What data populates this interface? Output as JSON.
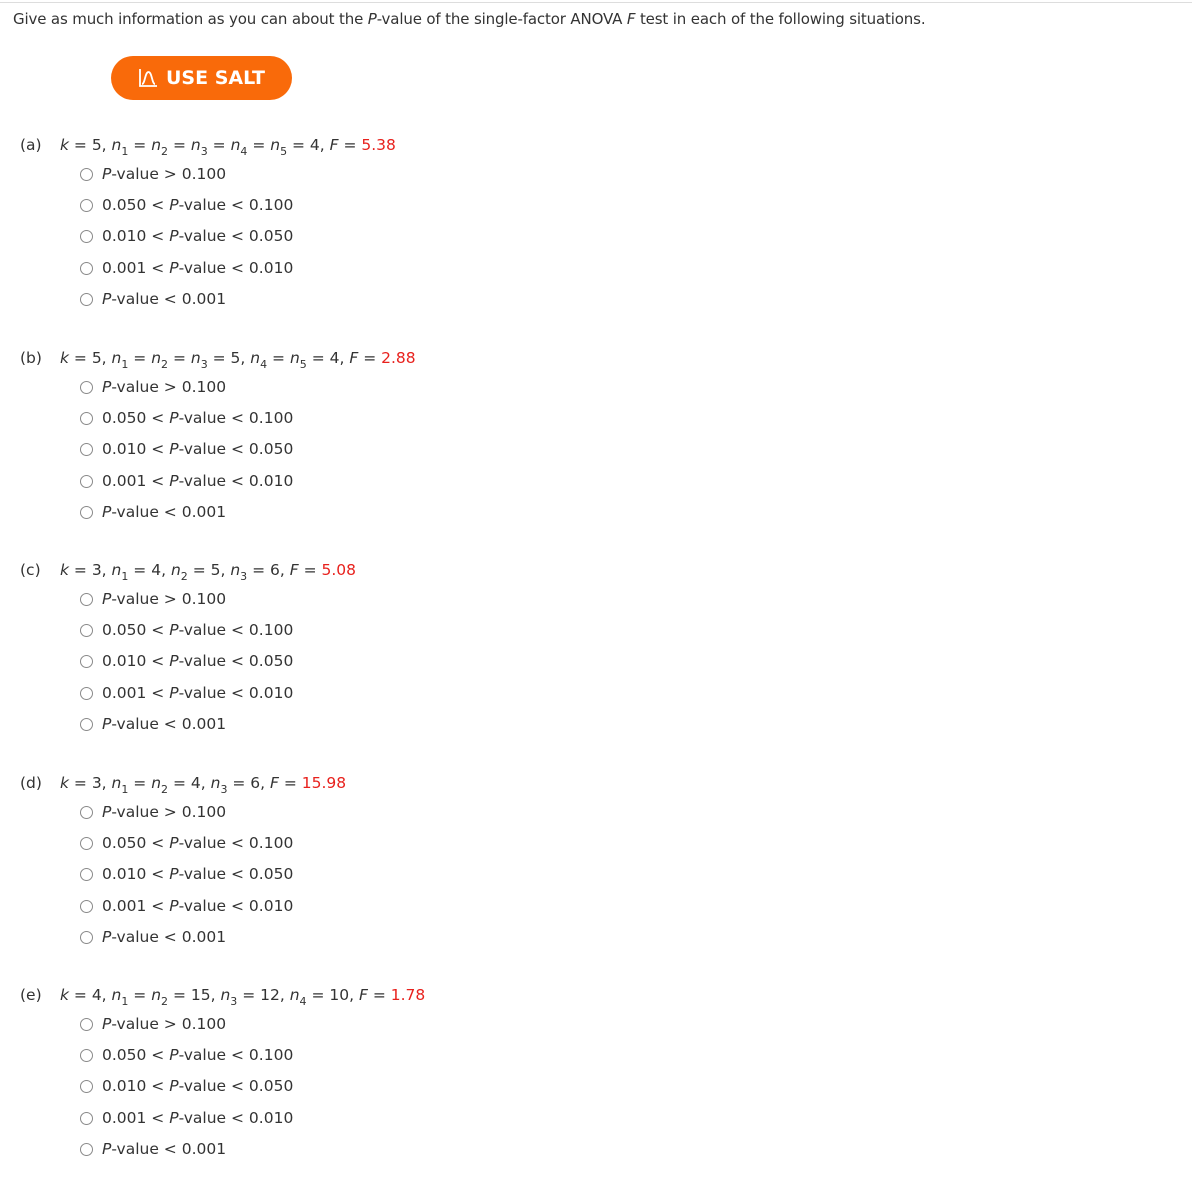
{
  "question": {
    "prefix": "Give as much information as you can about the ",
    "p_italic": "P",
    "middle": "-value of the single-factor ANOVA ",
    "f_italic": "F",
    "suffix": " test in each of the following situations."
  },
  "salt_button": {
    "label": "USE SALT",
    "icon": "distribution-curve-icon",
    "color": "#f96a0a"
  },
  "accent_color": "#e8211d",
  "options": [
    {
      "pre": "",
      "italic": "P",
      "post": "-value > 0.100"
    },
    {
      "pre": "0.050 < ",
      "italic": "P",
      "post": "-value < 0.100"
    },
    {
      "pre": "0.010 < ",
      "italic": "P",
      "post": "-value < 0.050"
    },
    {
      "pre": "0.001 < ",
      "italic": "P",
      "post": "-value < 0.010"
    },
    {
      "pre": "",
      "italic": "P",
      "post": "-value < 0.001"
    }
  ],
  "parts": [
    {
      "letter": "(a)",
      "tokens": [
        {
          "t": "k",
          "i": true
        },
        {
          "t": " = 5, "
        },
        {
          "t": "n",
          "i": true
        },
        {
          "s": "1"
        },
        {
          "t": " = "
        },
        {
          "t": "n",
          "i": true
        },
        {
          "s": "2"
        },
        {
          "t": " = "
        },
        {
          "t": "n",
          "i": true
        },
        {
          "s": "3"
        },
        {
          "t": " = "
        },
        {
          "t": "n",
          "i": true
        },
        {
          "s": "4"
        },
        {
          "t": " = "
        },
        {
          "t": "n",
          "i": true
        },
        {
          "s": "5"
        },
        {
          "t": " = 4, "
        },
        {
          "t": "F",
          "i": true
        },
        {
          "t": " = "
        }
      ],
      "F": "5.38"
    },
    {
      "letter": "(b)",
      "tokens": [
        {
          "t": "k",
          "i": true
        },
        {
          "t": " = 5, "
        },
        {
          "t": "n",
          "i": true
        },
        {
          "s": "1"
        },
        {
          "t": " = "
        },
        {
          "t": "n",
          "i": true
        },
        {
          "s": "2"
        },
        {
          "t": " = "
        },
        {
          "t": "n",
          "i": true
        },
        {
          "s": "3"
        },
        {
          "t": " = 5, "
        },
        {
          "t": "n",
          "i": true
        },
        {
          "s": "4"
        },
        {
          "t": " = "
        },
        {
          "t": "n",
          "i": true
        },
        {
          "s": "5"
        },
        {
          "t": " = 4, "
        },
        {
          "t": "F",
          "i": true
        },
        {
          "t": " = "
        }
      ],
      "F": "2.88"
    },
    {
      "letter": "(c)",
      "tokens": [
        {
          "t": "k",
          "i": true
        },
        {
          "t": " = 3, "
        },
        {
          "t": "n",
          "i": true
        },
        {
          "s": "1"
        },
        {
          "t": " = 4, "
        },
        {
          "t": "n",
          "i": true
        },
        {
          "s": "2"
        },
        {
          "t": " = 5, "
        },
        {
          "t": "n",
          "i": true
        },
        {
          "s": "3"
        },
        {
          "t": " = 6, "
        },
        {
          "t": "F",
          "i": true
        },
        {
          "t": " = "
        }
      ],
      "F": "5.08"
    },
    {
      "letter": "(d)",
      "tokens": [
        {
          "t": "k",
          "i": true
        },
        {
          "t": " = 3, "
        },
        {
          "t": "n",
          "i": true
        },
        {
          "s": "1"
        },
        {
          "t": " = "
        },
        {
          "t": "n",
          "i": true
        },
        {
          "s": "2"
        },
        {
          "t": " = 4, "
        },
        {
          "t": "n",
          "i": true
        },
        {
          "s": "3"
        },
        {
          "t": " = 6, "
        },
        {
          "t": "F",
          "i": true
        },
        {
          "t": " = "
        }
      ],
      "F": "15.98"
    },
    {
      "letter": "(e)",
      "tokens": [
        {
          "t": "k",
          "i": true
        },
        {
          "t": " = 4, "
        },
        {
          "t": "n",
          "i": true
        },
        {
          "s": "1"
        },
        {
          "t": " = "
        },
        {
          "t": "n",
          "i": true
        },
        {
          "s": "2"
        },
        {
          "t": " = 15, "
        },
        {
          "t": "n",
          "i": true
        },
        {
          "s": "3"
        },
        {
          "t": " = 12, "
        },
        {
          "t": "n",
          "i": true
        },
        {
          "s": "4"
        },
        {
          "t": " = 10, "
        },
        {
          "t": "F",
          "i": true
        },
        {
          "t": " = "
        }
      ],
      "F": "1.78"
    }
  ]
}
